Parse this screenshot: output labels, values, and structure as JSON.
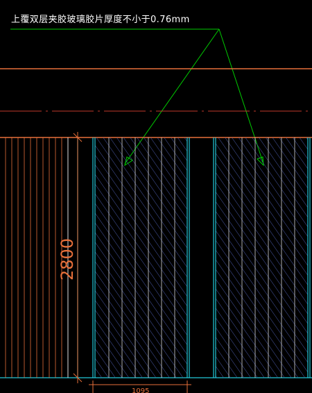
{
  "annotation": {
    "text": "上覆双层夹胶玻璃胶片厚度不小于0.76mm"
  },
  "dimensions": {
    "height_label": "2800",
    "width_label": "1095"
  },
  "colors": {
    "background": "#000000",
    "leader_line": "#00cc00",
    "orange_line": "#e8703a",
    "red_dashed": "#c0392b",
    "cyan_frame": "#22c8d8",
    "hatch": "#4a5aa8",
    "white_mullion": "#e0e0e0"
  }
}
